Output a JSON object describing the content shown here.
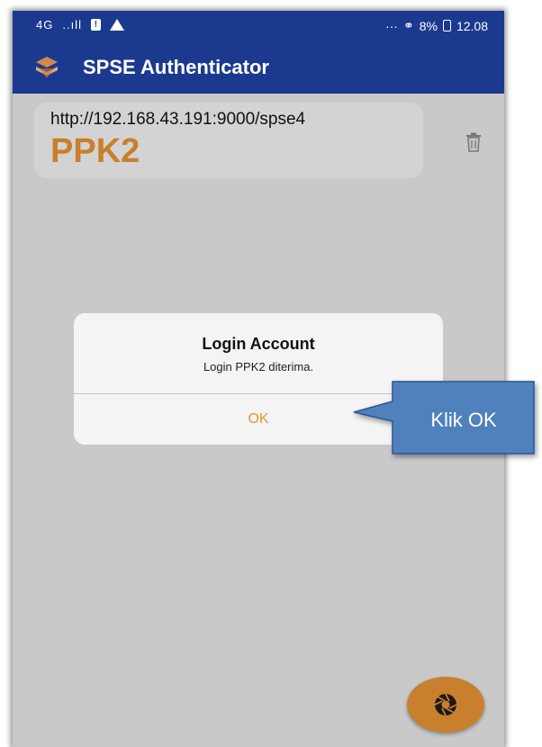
{
  "status_bar": {
    "network": "4G",
    "signal": "..ıll",
    "overflow": "···",
    "battery": "8%",
    "time": "12.08"
  },
  "app": {
    "title": "SPSE Authenticator",
    "bar_color": "#1b3a8f",
    "accent_color": "#c97f2c"
  },
  "account": {
    "url": "http://192.168.43.191:9000/spse4",
    "name": "PPK2",
    "delete_icon": "trash-icon"
  },
  "dialog": {
    "title": "Login Account",
    "message": "Login PPK2 diterima.",
    "ok_label": "OK"
  },
  "fab": {
    "icon": "shutter-icon"
  },
  "callout": {
    "text": "Klik OK",
    "fill_color": "#4f81bd"
  }
}
